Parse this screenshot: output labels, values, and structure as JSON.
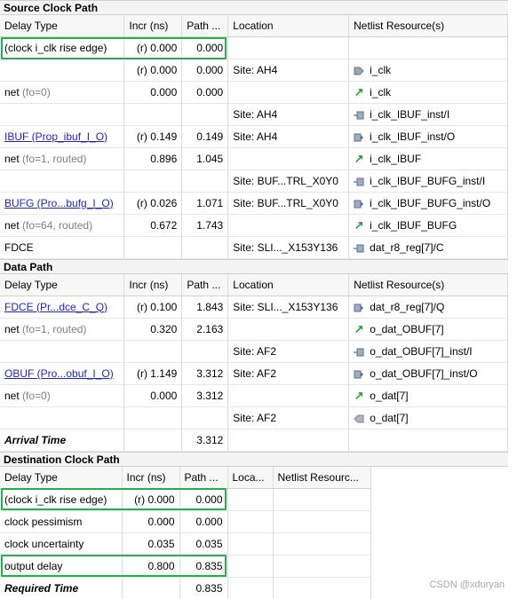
{
  "source": {
    "title": "Source Clock Path",
    "headers": [
      "Delay Type",
      "Incr (ns)",
      "Path ...",
      "Location",
      "Netlist Resource(s)"
    ],
    "rows": [
      {
        "type": "(clock i_clk rise edge)",
        "incr": "(r) 0.000",
        "path": "0.000",
        "loc": "",
        "res": "",
        "icon": ""
      },
      {
        "type": "",
        "incr": "(r) 0.000",
        "path": "0.000",
        "loc": "Site: AH4",
        "res": "i_clk",
        "icon": "port-in"
      },
      {
        "type": "net",
        "extra": "(fo=0)",
        "incr": "0.000",
        "path": "0.000",
        "loc": "",
        "res": "i_clk",
        "icon": "net"
      },
      {
        "type": "",
        "incr": "",
        "path": "",
        "loc": "Site: AH4",
        "res": "i_clk_IBUF_inst/I",
        "icon": "pin-in"
      },
      {
        "type": "IBUF (Prop_ibuf_I_O)",
        "link": true,
        "incr": "(r) 0.149",
        "path": "0.149",
        "loc": "Site: AH4",
        "res": "i_clk_IBUF_inst/O",
        "icon": "pin-out"
      },
      {
        "type": "net",
        "extra": "(fo=1, routed)",
        "incr": "0.896",
        "path": "1.045",
        "loc": "",
        "res": "i_clk_IBUF",
        "icon": "net"
      },
      {
        "type": "",
        "incr": "",
        "path": "",
        "loc": "Site: BUF...TRL_X0Y0",
        "res": "i_clk_IBUF_BUFG_inst/I",
        "icon": "pin-in"
      },
      {
        "type": "BUFG (Pro...bufg_I_O)",
        "link": true,
        "incr": "(r) 0.026",
        "path": "1.071",
        "loc": "Site: BUF...TRL_X0Y0",
        "res": "i_clk_IBUF_BUFG_inst/O",
        "icon": "pin-out"
      },
      {
        "type": "net",
        "extra": "(fo=64, routed)",
        "incr": "0.672",
        "path": "1.743",
        "loc": "",
        "res": "i_clk_IBUF_BUFG",
        "icon": "net"
      },
      {
        "type": "FDCE",
        "incr": "",
        "path": "",
        "loc": "Site: SLI..._X153Y136",
        "res": "dat_r8_reg[7]/C",
        "icon": "pin-in"
      }
    ]
  },
  "data_path": {
    "title": "Data Path",
    "headers": [
      "Delay Type",
      "Incr (ns)",
      "Path ...",
      "Location",
      "Netlist Resource(s)"
    ],
    "rows": [
      {
        "type": "FDCE (Pr...dce_C_Q)",
        "link": true,
        "incr": "(r) 0.100",
        "path": "1.843",
        "loc": "Site: SLI..._X153Y136",
        "res": "dat_r8_reg[7]/Q",
        "icon": "pin-out"
      },
      {
        "type": "net",
        "extra": "(fo=1, routed)",
        "incr": "0.320",
        "path": "2.163",
        "loc": "",
        "res": "o_dat_OBUF[7]",
        "icon": "net"
      },
      {
        "type": "",
        "incr": "",
        "path": "",
        "loc": "Site: AF2",
        "res": "o_dat_OBUF[7]_inst/I",
        "icon": "pin-in"
      },
      {
        "type": "OBUF (Pro...obuf_I_O)",
        "link": true,
        "incr": "(r) 1.149",
        "path": "3.312",
        "loc": "Site: AF2",
        "res": "o_dat_OBUF[7]_inst/O",
        "icon": "pin-out"
      },
      {
        "type": "net",
        "extra": "(fo=0)",
        "incr": "0.000",
        "path": "3.312",
        "loc": "",
        "res": "o_dat[7]",
        "icon": "net"
      },
      {
        "type": "",
        "incr": "",
        "path": "",
        "loc": "Site: AF2",
        "res": "o_dat[7]",
        "icon": "port-out"
      },
      {
        "type": "Arrival Time",
        "bolditalic": true,
        "incr": "",
        "path": "3.312",
        "loc": "",
        "res": "",
        "icon": ""
      }
    ]
  },
  "dest": {
    "title": "Destination Clock Path",
    "headers": [
      "Delay Type",
      "Incr (ns)",
      "Path ...",
      "Loca...",
      "Netlist Resourc..."
    ],
    "rows": [
      {
        "type": "(clock i_clk rise edge)",
        "incr": "(r) 0.000",
        "path": "0.000"
      },
      {
        "type": "clock pessimism",
        "incr": "0.000",
        "path": "0.000"
      },
      {
        "type": "clock uncertainty",
        "incr": "0.035",
        "path": "0.035"
      },
      {
        "type": "output delay",
        "incr": "0.800",
        "path": "0.835"
      },
      {
        "type": "Required Time",
        "bolditalic": true,
        "incr": "",
        "path": "0.835"
      }
    ]
  },
  "watermark": "CSDN @xduryan",
  "colors": {
    "highlight": "#21b24b",
    "link": "#2222cc",
    "net_icon": "#2aa040",
    "port_icon": "#9aa6b2"
  }
}
